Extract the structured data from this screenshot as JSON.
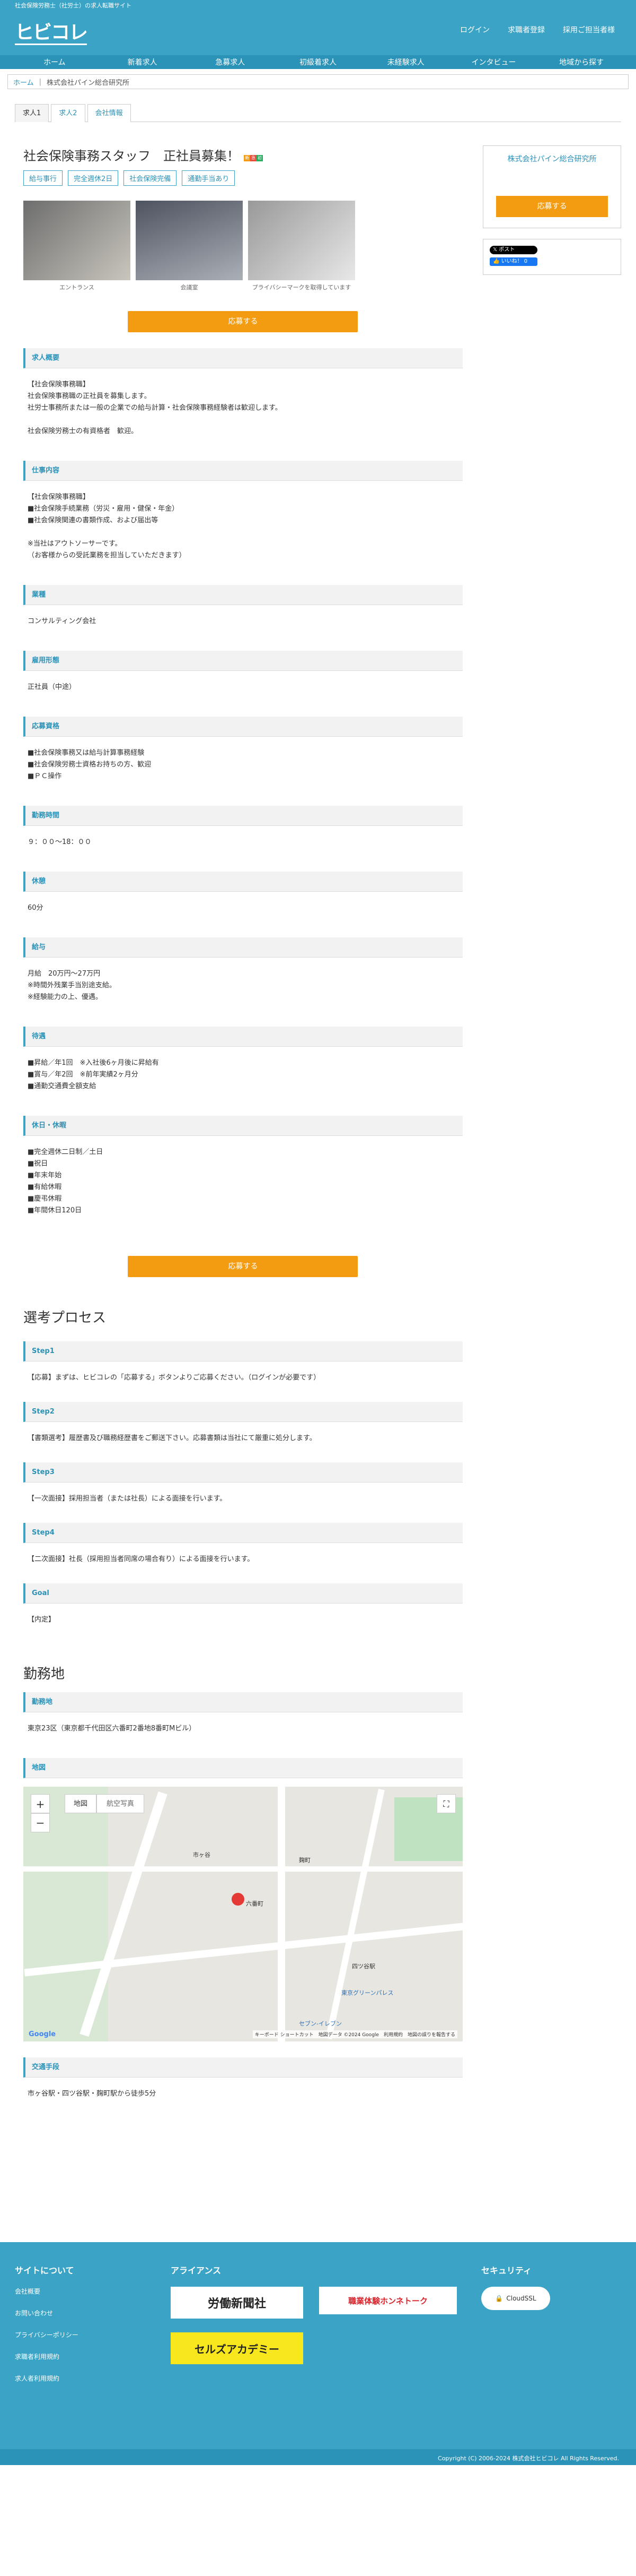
{
  "topbar": "社会保険労務士（社労士）の求人転職サイト",
  "logo": "ヒビコレ",
  "header_links": [
    "ログイン",
    "求職者登録",
    "採用ご担当者様"
  ],
  "nav": [
    "ホーム",
    "新着求人",
    "急募求人",
    "初級着求人",
    "未経験求人",
    "インタビュー",
    "地域から探す"
  ],
  "breadcrumb": {
    "home": "ホーム",
    "current": "株式会社パイン総合研究所"
  },
  "tabs": [
    "求人1",
    "求人2",
    "会社情報"
  ],
  "job": {
    "title": "社会保険事務スタッフ　正社員募集！",
    "badges": [
      "給与事行",
      "完全週休2日",
      "社会保険完備",
      "通勤手当あり"
    ]
  },
  "photos": [
    {
      "caption": "エントランス"
    },
    {
      "caption": "会議室"
    },
    {
      "caption": "プライバシーマークを取得しています"
    }
  ],
  "apply_label": "応募する",
  "sections": [
    {
      "h": "求人概要",
      "b": "【社会保険事務職】\n社会保険事務職の正社員を募集します。\n社労士事務所または一般の企業での給与計算・社会保険事務経験者は歓迎します。\n\n社会保険労務士の有資格者　歓迎。"
    },
    {
      "h": "仕事内容",
      "b": "【社会保険事務職】\n■社会保険手続業務（労災・雇用・健保・年金）\n■社会保険関連の書類作成、および届出等\n\n※当社はアウトソーサーです。\n（お客様からの受託業務を担当していただきます）"
    },
    {
      "h": "業種",
      "b": "コンサルティング会社"
    },
    {
      "h": "雇用形態",
      "b": "正社員（中途）"
    },
    {
      "h": "応募資格",
      "b": "■社会保険事務又は給与計算事務経験\n■社会保険労務士資格お持ちの方、歓迎\n■ＰＣ操作"
    },
    {
      "h": "勤務時間",
      "b": "９：００～18：００"
    },
    {
      "h": "休憩",
      "b": "60分"
    },
    {
      "h": "給与",
      "b": "月給　20万円～27万円\n※時間外残業手当別途支給。\n※経験能力の上、優遇。"
    },
    {
      "h": "待遇",
      "b": "■昇給／年1回　※入社後6ヶ月後に昇給有\n■賞与／年2回　※前年実績2ヶ月分\n■通勤交通費全額支給"
    },
    {
      "h": "休日・休暇",
      "b": "■完全週休二日制／土日\n■祝日\n■年末年始\n■有給休暇\n■慶弔休暇\n■年間休日120日"
    }
  ],
  "process": {
    "title": "選考プロセス",
    "steps": [
      {
        "h": "Step1",
        "b": "【応募】まずは、ヒビコレの「応募する」ボタンよりご応募ください。（ログインが必要です）"
      },
      {
        "h": "Step2",
        "b": "【書類選考】履歴書及び職務経歴書をご郵送下さい。応募書類は当社にて厳重に処分します。"
      },
      {
        "h": "Step3",
        "b": "【一次面接】採用担当者（または社長）による面接を行います。"
      },
      {
        "h": "Step4",
        "b": "【二次面接】社長（採用担当者同席の場合有り）による面接を行います。"
      },
      {
        "h": "Goal",
        "b": "【内定】"
      }
    ]
  },
  "location": {
    "title": "勤務地",
    "area_h": "勤務地",
    "area_b": "東京23区（東京都千代田区六番町2番地8番町Mビル）",
    "map_h": "地図",
    "map_tabs": [
      "地図",
      "航空写真"
    ],
    "map_labels": [
      "六番町",
      "麹町",
      "市ヶ谷",
      "四ツ谷駅",
      "東京グリーンパレス",
      "セブン-イレブン"
    ],
    "map_footer": "キーボード ショートカット　地図データ ©2024 Google　利用規約　地図の誤りを報告する",
    "access_h": "交通手段",
    "access_b": "市ヶ谷駅・四ツ谷駅・麹町駅から徒歩5分"
  },
  "side": {
    "company": "株式会社パイン総合研究所",
    "apply": "応募する",
    "tweet": "ポスト",
    "like": "いいね！ 0"
  },
  "footer": {
    "about_h": "サイトについて",
    "about_links": [
      "会社概要",
      "お問い合わせ",
      "プライバシーポリシー",
      "求職者利用規約",
      "求人者利用規約"
    ],
    "alliance_h": "アライアンス",
    "banners": [
      "労働新聞社",
      "職業体験ホンネトーク",
      "セルズアカデミー"
    ],
    "security_h": "セキュリティ",
    "security_seal": "CloudSSL",
    "copyright": "Copyright (C) 2006-2024 株式会社ヒビコレ All Rights Reserved."
  }
}
